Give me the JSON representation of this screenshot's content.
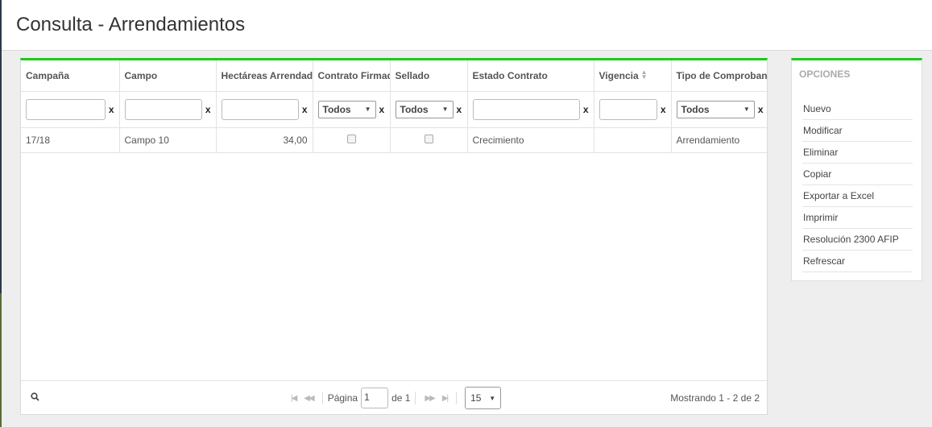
{
  "page": {
    "title": "Consulta - Arrendamientos"
  },
  "grid": {
    "columns": [
      "Campaña",
      "Campo",
      "Hectáreas Arrendadas",
      "Contrato Firmado",
      "Sellado",
      "Estado Contrato",
      "Vigencia",
      "Tipo de Comprobante"
    ],
    "filters": {
      "contrato_firmado": "Todos",
      "sellado": "Todos",
      "tipo_comprobante": "Todos",
      "clear": "x"
    },
    "rows": [
      {
        "campania": "17/18",
        "campo": "Campo 10",
        "hectareas": "34,00",
        "contrato_firmado": false,
        "sellado": false,
        "estado": "Crecimiento",
        "vigencia": "",
        "tipo": "Arrendamiento"
      }
    ],
    "footer": {
      "page_label": "Página",
      "page_value": "1",
      "of_label": "de 1",
      "page_size": "15",
      "showing": "Mostrando 1 - 2 de 2"
    }
  },
  "options": {
    "title": "OPCIONES",
    "items": [
      "Nuevo",
      "Modificar",
      "Eliminar",
      "Copiar",
      "Exportar a Excel",
      "Imprimir",
      "Resolución 2300 AFIP",
      "Refrescar"
    ]
  },
  "colors": {
    "accent": "#1ec81e",
    "background": "#eeeeee"
  }
}
